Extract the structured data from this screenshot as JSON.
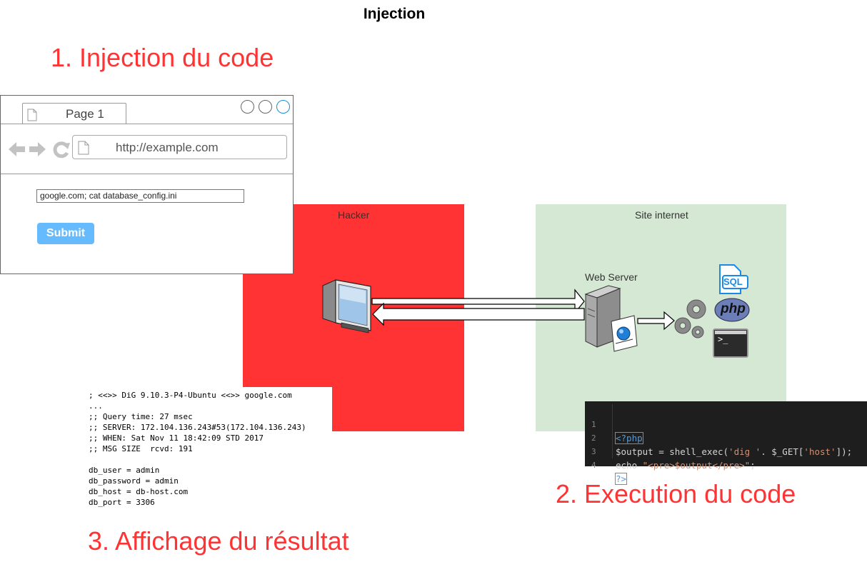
{
  "title": "Injection",
  "steps": {
    "step1": "1. Injection du code",
    "step2": "2. Execution du code",
    "step3": "3. Affichage du résultat"
  },
  "zones": {
    "hacker_label": "Hacker",
    "site_label": "Site internet",
    "web_server_label": "Web Server"
  },
  "browser": {
    "tab_label": "Page 1",
    "url": "http://example.com",
    "input_value": "google.com; cat database_config.ini",
    "submit_label": "Submit"
  },
  "icons": {
    "sql_label": "SQL",
    "php_label": "php",
    "terminal_label": ">_"
  },
  "output_lines": [
    "; <<>> DiG 9.10.3-P4-Ubuntu <<>> google.com",
    "...",
    ";; Query time: 27 msec",
    ";; SERVER: 172.104.136.243#53(172.104.136.243)",
    ";; WHEN: Sat Nov 11 18:42:09 STD 2017",
    ";; MSG SIZE  rcvd: 191",
    "",
    "db_user = admin",
    "db_password = admin",
    "db_host = db-host.com",
    "db_port = 3306"
  ],
  "code": {
    "line_numbers": [
      "1",
      "2",
      "3",
      "4"
    ],
    "line1": "<?php",
    "line2_a": "$output = shell_exec(",
    "line2_b": "'dig '",
    "line2_c": ". $_GET[",
    "line2_d": "'host'",
    "line2_e": "]);",
    "line3_a": "echo ",
    "line3_b": "\"<pre>$output</pre>\"",
    "line3_c": ";",
    "line4": "?>"
  },
  "colors": {
    "accent_red": "#ff3333",
    "site_green": "#d5e8d4",
    "submit_blue": "#66bbff",
    "code_bg": "#1e1e1e"
  }
}
